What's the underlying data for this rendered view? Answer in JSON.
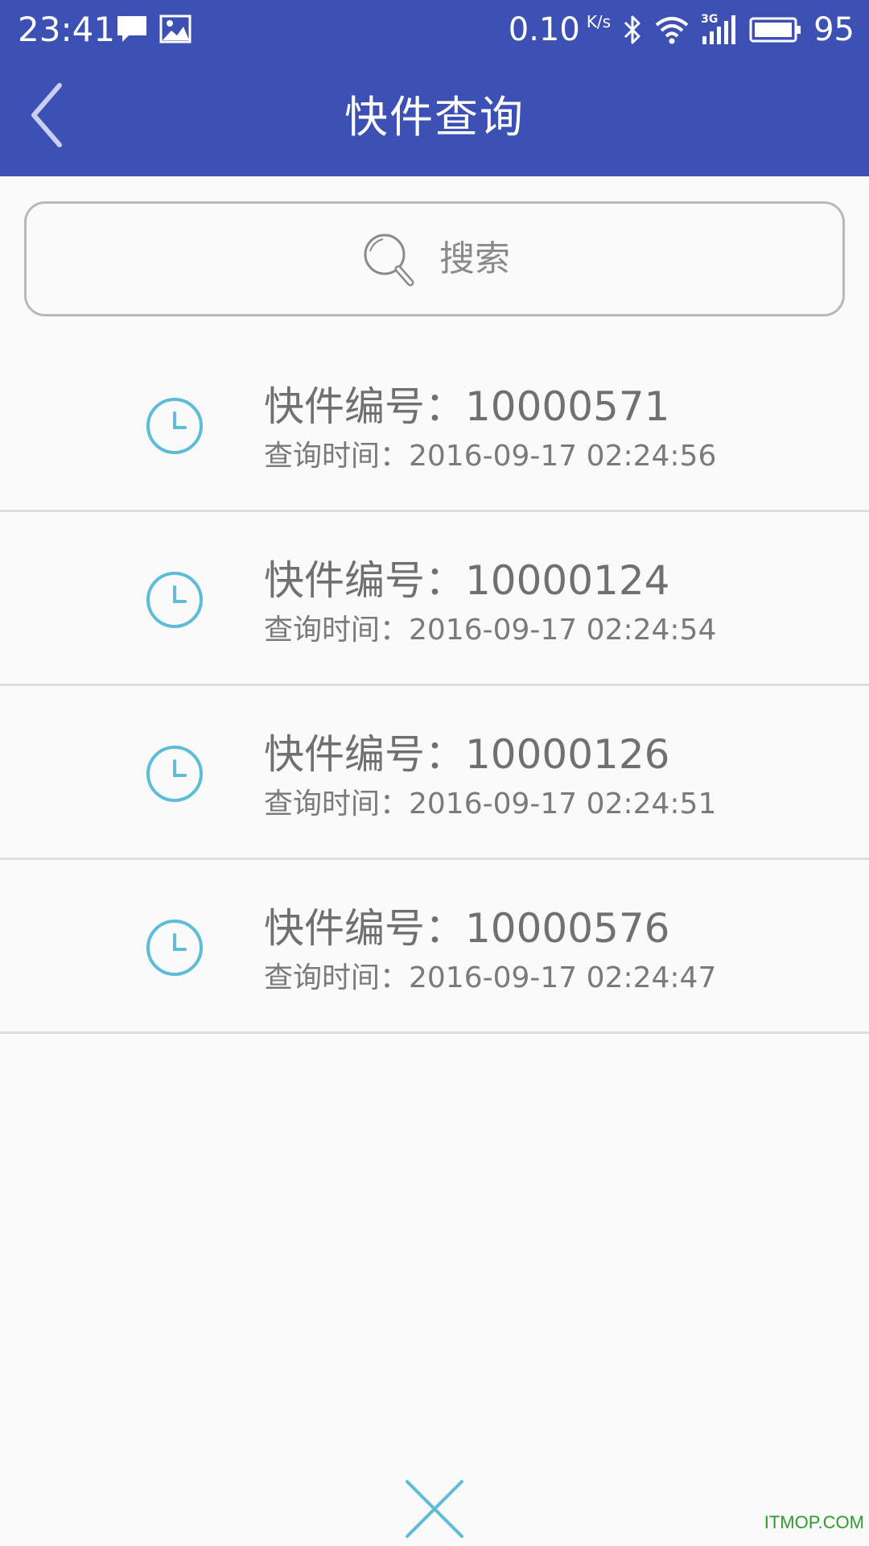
{
  "status_bar": {
    "time": "23:41",
    "net_speed": "0.10",
    "net_speed_unit": "K/s",
    "network_type": "3G",
    "battery": "95",
    "icons": [
      "message-icon",
      "image-icon",
      "bluetooth-icon",
      "wifi-icon",
      "signal-icon",
      "battery-icon"
    ]
  },
  "header": {
    "title": "快件查询",
    "back_icon": "chevron-left-icon"
  },
  "search": {
    "placeholder": "搜索",
    "icon": "search-icon"
  },
  "history": [
    {
      "number": "快件编号：10000571",
      "time": "查询时间：2016-09-17 02:24:56"
    },
    {
      "number": "快件编号：10000124",
      "time": "查询时间：2016-09-17 02:24:54"
    },
    {
      "number": "快件编号：10000126",
      "time": "查询时间：2016-09-17 02:24:51"
    },
    {
      "number": "快件编号：10000576",
      "time": "查询时间：2016-09-17 02:24:47"
    }
  ],
  "close_icon": "close-icon",
  "watermark": "ITMOP.COM",
  "colors": {
    "header_bg": "#3d51b5",
    "accent": "#5ebcd8",
    "text": "#707070",
    "background": "#fafafa",
    "watermark": "#2e9b2e"
  }
}
